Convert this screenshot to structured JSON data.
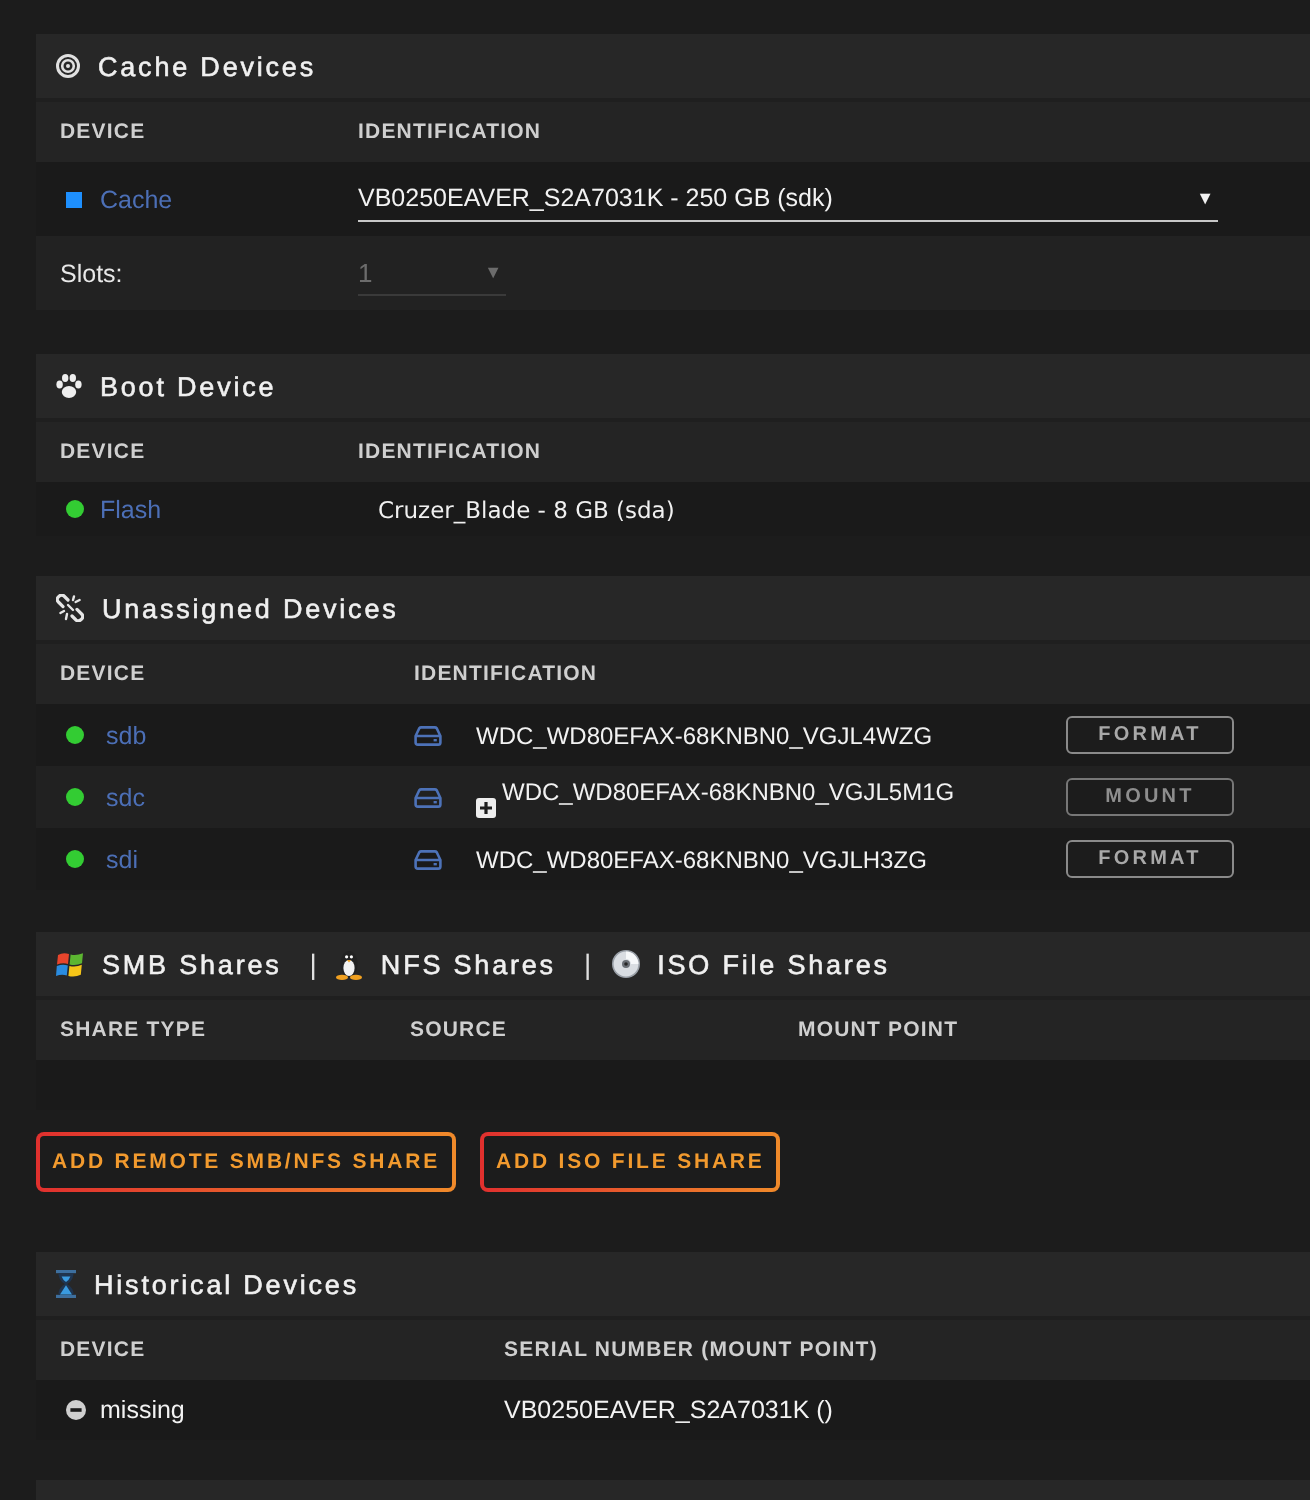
{
  "panels": [
    {
      "kind": "cache",
      "title": "Cache Devices",
      "columns": [
        "DEVICE",
        "IDENTIFICATION"
      ],
      "rows": [
        {
          "device": "Cache",
          "color": "#1e90ff",
          "identification": "VB0250EAVER_S2A7031K - 250 GB (sdk)",
          "caret": "▼"
        }
      ],
      "slots": {
        "label": "Slots:",
        "value": "1",
        "caret": "▼",
        "disabled": true
      }
    },
    {
      "kind": "boot",
      "title": "Boot Device",
      "columns": [
        "DEVICE",
        "IDENTIFICATION"
      ],
      "rows": [
        {
          "device": "Flash",
          "color": "#33cc33",
          "identification": "Cruzer_Blade - 8 GB (sda)"
        }
      ]
    },
    {
      "kind": "unassigned",
      "title": "Unassigned Devices",
      "columns": [
        "DEVICE",
        "IDENTIFICATION"
      ],
      "rows": [
        {
          "device": "sdb",
          "color": "#33cc33",
          "identification": "WDC_WD80EFAX-68KNBN0_VGJL4WZG",
          "expandable": false,
          "action": {
            "kind": "format",
            "label": "FORMAT"
          }
        },
        {
          "device": "sdc",
          "color": "#33cc33",
          "identification": "WDC_WD80EFAX-68KNBN0_VGJL5M1G",
          "expandable": true,
          "action": {
            "kind": "mount",
            "label": "MOUNT"
          }
        },
        {
          "device": "sdi",
          "color": "#33cc33",
          "identification": "WDC_WD80EFAX-68KNBN0_VGJLH3ZG",
          "expandable": false,
          "action": {
            "kind": "format",
            "label": "FORMAT"
          }
        }
      ]
    },
    {
      "kind": "shares",
      "title_parts": [
        {
          "kind": "smb",
          "label": "SMB Shares"
        },
        {
          "kind": "nfs",
          "separator": "|",
          "label": "NFS Shares"
        },
        {
          "kind": "iso",
          "separator": "|",
          "label": "ISO File Shares"
        }
      ],
      "columns": [
        "SHARE TYPE",
        "SOURCE",
        "MOUNT POINT"
      ],
      "buttons": [
        "ADD REMOTE SMB/NFS SHARE",
        "ADD ISO FILE SHARE"
      ]
    },
    {
      "kind": "historical",
      "title": "Historical Devices",
      "columns": [
        "DEVICE",
        "SERIAL NUMBER (MOUNT POINT)"
      ],
      "rows": [
        {
          "device": "missing",
          "serial": "VB0250EAVER_S2A7031K ()"
        }
      ]
    }
  ]
}
